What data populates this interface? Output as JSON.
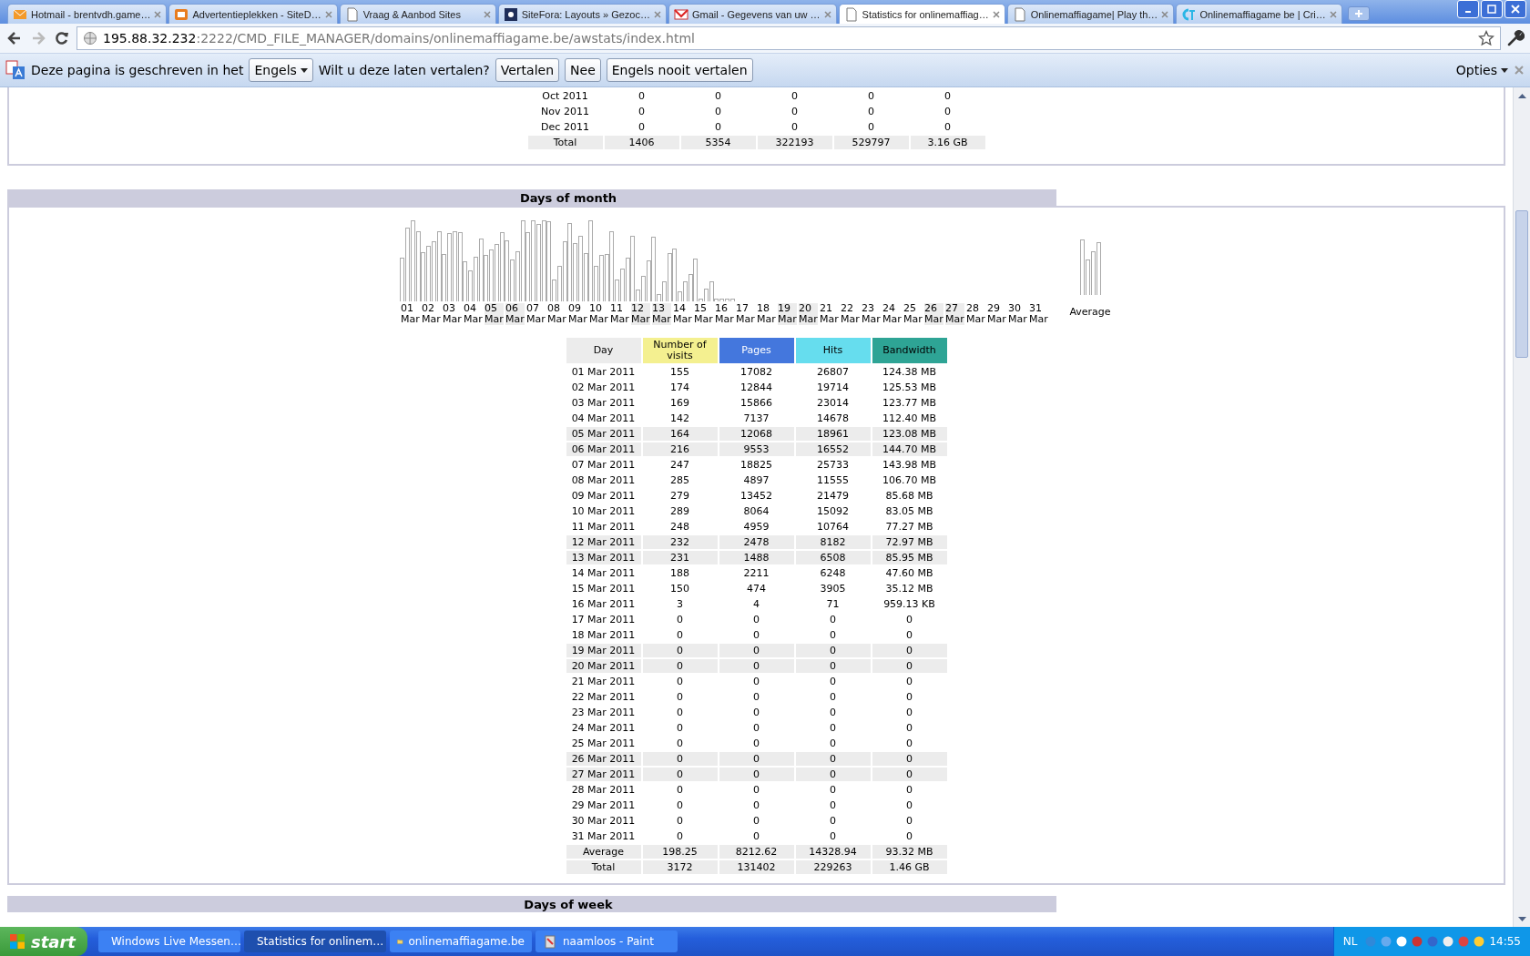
{
  "browser": {
    "tabs": [
      {
        "title": "Hotmail - brentvdh.game…",
        "selected": false
      },
      {
        "title": "Advertentieplekken - SiteD…",
        "selected": false
      },
      {
        "title": "Vraag & Aanbod Sites",
        "selected": false
      },
      {
        "title": "SiteFora: Layouts » Gezoc…",
        "selected": false
      },
      {
        "title": "Gmail - Gegevens van uw …",
        "selected": false
      },
      {
        "title": "Statistics for onlinemaffiag…",
        "selected": true
      },
      {
        "title": "Onlinemaffiagame| Play th…",
        "selected": false
      },
      {
        "title": "Onlinemaffiagame be | Cri…",
        "selected": false
      }
    ],
    "address": {
      "host": "195.88.32.232",
      "path": ":2222/CMD_FILE_MANAGER/domains/onlinemaffiagame.be/awstats/index.html"
    }
  },
  "translate_bar": {
    "message": "Deze pagina is geschreven in het",
    "language": "Engels",
    "question": "Wilt u deze laten vertalen?",
    "buttons": [
      "Vertalen",
      "Nee",
      "Engels nooit vertalen"
    ],
    "options": "Opties"
  },
  "months_table": {
    "rows": [
      [
        "Oct 2011",
        "0",
        "0",
        "0",
        "0",
        "0"
      ],
      [
        "Nov 2011",
        "0",
        "0",
        "0",
        "0",
        "0"
      ],
      [
        "Dec 2011",
        "0",
        "0",
        "0",
        "0",
        "0"
      ]
    ],
    "total": [
      "Total",
      "1406",
      "5354",
      "322193",
      "529797",
      "3.16 GB"
    ]
  },
  "days_of_month": {
    "title": "Days of month",
    "chart": {
      "average_label": "Average",
      "days": [
        {
          "day": "01",
          "month": "Mar",
          "weekend": false
        },
        {
          "day": "02",
          "month": "Mar",
          "weekend": false
        },
        {
          "day": "03",
          "month": "Mar",
          "weekend": false
        },
        {
          "day": "04",
          "month": "Mar",
          "weekend": false
        },
        {
          "day": "05",
          "month": "Mar",
          "weekend": true
        },
        {
          "day": "06",
          "month": "Mar",
          "weekend": true
        },
        {
          "day": "07",
          "month": "Mar",
          "weekend": false
        },
        {
          "day": "08",
          "month": "Mar",
          "weekend": false
        },
        {
          "day": "09",
          "month": "Mar",
          "weekend": false
        },
        {
          "day": "10",
          "month": "Mar",
          "weekend": false
        },
        {
          "day": "11",
          "month": "Mar",
          "weekend": false
        },
        {
          "day": "12",
          "month": "Mar",
          "weekend": true
        },
        {
          "day": "13",
          "month": "Mar",
          "weekend": true
        },
        {
          "day": "14",
          "month": "Mar",
          "weekend": false
        },
        {
          "day": "15",
          "month": "Mar",
          "weekend": false
        },
        {
          "day": "16",
          "month": "Mar",
          "weekend": false
        },
        {
          "day": "17",
          "month": "Mar",
          "weekend": false
        },
        {
          "day": "18",
          "month": "Mar",
          "weekend": false
        },
        {
          "day": "19",
          "month": "Mar",
          "weekend": true
        },
        {
          "day": "20",
          "month": "Mar",
          "weekend": true
        },
        {
          "day": "21",
          "month": "Mar",
          "weekend": false
        },
        {
          "day": "22",
          "month": "Mar",
          "weekend": false
        },
        {
          "day": "23",
          "month": "Mar",
          "weekend": false
        },
        {
          "day": "24",
          "month": "Mar",
          "weekend": false
        },
        {
          "day": "25",
          "month": "Mar",
          "weekend": false
        },
        {
          "day": "26",
          "month": "Mar",
          "weekend": true
        },
        {
          "day": "27",
          "month": "Mar",
          "weekend": true
        },
        {
          "day": "28",
          "month": "Mar",
          "weekend": false
        },
        {
          "day": "29",
          "month": "Mar",
          "weekend": false
        },
        {
          "day": "30",
          "month": "Mar",
          "weekend": false
        },
        {
          "day": "31",
          "month": "Mar",
          "weekend": false
        }
      ]
    },
    "columns": [
      {
        "label": "Day",
        "color": "#ececec"
      },
      {
        "label": "Number of visits",
        "color": "#f4f090"
      },
      {
        "label": "Pages",
        "color": "#4477dd"
      },
      {
        "label": "Hits",
        "color": "#66ddee"
      },
      {
        "label": "Bandwidth",
        "color": "#2ea495"
      }
    ],
    "rows": [
      {
        "cells": [
          "01 Mar 2011",
          "155",
          "17082",
          "26807",
          "124.38 MB"
        ],
        "weekend": false
      },
      {
        "cells": [
          "02 Mar 2011",
          "174",
          "12844",
          "19714",
          "125.53 MB"
        ],
        "weekend": false
      },
      {
        "cells": [
          "03 Mar 2011",
          "169",
          "15866",
          "23014",
          "123.77 MB"
        ],
        "weekend": false
      },
      {
        "cells": [
          "04 Mar 2011",
          "142",
          "7137",
          "14678",
          "112.40 MB"
        ],
        "weekend": false
      },
      {
        "cells": [
          "05 Mar 2011",
          "164",
          "12068",
          "18961",
          "123.08 MB"
        ],
        "weekend": true
      },
      {
        "cells": [
          "06 Mar 2011",
          "216",
          "9553",
          "16552",
          "144.70 MB"
        ],
        "weekend": true
      },
      {
        "cells": [
          "07 Mar 2011",
          "247",
          "18825",
          "25733",
          "143.98 MB"
        ],
        "weekend": false
      },
      {
        "cells": [
          "08 Mar 2011",
          "285",
          "4897",
          "11555",
          "106.70 MB"
        ],
        "weekend": false
      },
      {
        "cells": [
          "09 Mar 2011",
          "279",
          "13452",
          "21479",
          "85.68 MB"
        ],
        "weekend": false
      },
      {
        "cells": [
          "10 Mar 2011",
          "289",
          "8064",
          "15092",
          "83.05 MB"
        ],
        "weekend": false
      },
      {
        "cells": [
          "11 Mar 2011",
          "248",
          "4959",
          "10764",
          "77.27 MB"
        ],
        "weekend": false
      },
      {
        "cells": [
          "12 Mar 2011",
          "232",
          "2478",
          "8182",
          "72.97 MB"
        ],
        "weekend": true
      },
      {
        "cells": [
          "13 Mar 2011",
          "231",
          "1488",
          "6508",
          "85.95 MB"
        ],
        "weekend": true
      },
      {
        "cells": [
          "14 Mar 2011",
          "188",
          "2211",
          "6248",
          "47.60 MB"
        ],
        "weekend": false
      },
      {
        "cells": [
          "15 Mar 2011",
          "150",
          "474",
          "3905",
          "35.12 MB"
        ],
        "weekend": false
      },
      {
        "cells": [
          "16 Mar 2011",
          "3",
          "4",
          "71",
          "959.13 KB"
        ],
        "weekend": false
      },
      {
        "cells": [
          "17 Mar 2011",
          "0",
          "0",
          "0",
          "0"
        ],
        "weekend": false
      },
      {
        "cells": [
          "18 Mar 2011",
          "0",
          "0",
          "0",
          "0"
        ],
        "weekend": false
      },
      {
        "cells": [
          "19 Mar 2011",
          "0",
          "0",
          "0",
          "0"
        ],
        "weekend": true
      },
      {
        "cells": [
          "20 Mar 2011",
          "0",
          "0",
          "0",
          "0"
        ],
        "weekend": true
      },
      {
        "cells": [
          "21 Mar 2011",
          "0",
          "0",
          "0",
          "0"
        ],
        "weekend": false
      },
      {
        "cells": [
          "22 Mar 2011",
          "0",
          "0",
          "0",
          "0"
        ],
        "weekend": false
      },
      {
        "cells": [
          "23 Mar 2011",
          "0",
          "0",
          "0",
          "0"
        ],
        "weekend": false
      },
      {
        "cells": [
          "24 Mar 2011",
          "0",
          "0",
          "0",
          "0"
        ],
        "weekend": false
      },
      {
        "cells": [
          "25 Mar 2011",
          "0",
          "0",
          "0",
          "0"
        ],
        "weekend": false
      },
      {
        "cells": [
          "26 Mar 2011",
          "0",
          "0",
          "0",
          "0"
        ],
        "weekend": true
      },
      {
        "cells": [
          "27 Mar 2011",
          "0",
          "0",
          "0",
          "0"
        ],
        "weekend": true
      },
      {
        "cells": [
          "28 Mar 2011",
          "0",
          "0",
          "0",
          "0"
        ],
        "weekend": false
      },
      {
        "cells": [
          "29 Mar 2011",
          "0",
          "0",
          "0",
          "0"
        ],
        "weekend": false
      },
      {
        "cells": [
          "30 Mar 2011",
          "0",
          "0",
          "0",
          "0"
        ],
        "weekend": false
      },
      {
        "cells": [
          "31 Mar 2011",
          "0",
          "0",
          "0",
          "0"
        ],
        "weekend": false
      }
    ],
    "average": [
      "Average",
      "198.25",
      "8212.62",
      "14328.94",
      "93.32 MB"
    ],
    "total": [
      "Total",
      "3172",
      "131402",
      "229263",
      "1.46 GB"
    ]
  },
  "next_section_title": "Days of week",
  "taskbar": {
    "start": "start",
    "tasks": [
      {
        "label": "Windows Live Messen…",
        "selected": false
      },
      {
        "label": "Statistics for onlinem…",
        "selected": true
      },
      {
        "label": "onlinemaffiagame.be",
        "selected": false
      },
      {
        "label": "naamloos - Paint",
        "selected": false
      }
    ],
    "language": "NL",
    "clock": "14:55"
  }
}
